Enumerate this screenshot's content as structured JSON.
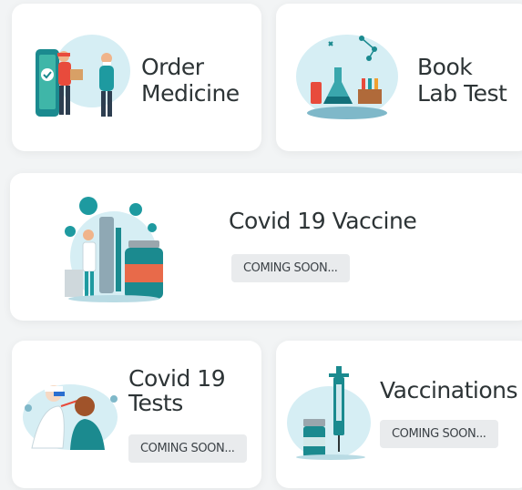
{
  "cards": {
    "order_medicine": {
      "title_line1": "Order",
      "title_line2": "Medicine",
      "icon": "medicine-delivery-icon"
    },
    "book_lab_test": {
      "title_line1": "Book",
      "title_line2": "Lab Test",
      "icon": "lab-flask-icon"
    },
    "covid_vaccine": {
      "title": "Covid 19 Vaccine",
      "badge": "COMING SOON...",
      "icon": "vaccine-vial-icon"
    },
    "covid_tests": {
      "title_line1": "Covid 19",
      "title_line2": "Tests",
      "badge": "COMING SOON...",
      "icon": "swab-test-icon"
    },
    "vaccinations": {
      "title": "Vaccinations",
      "badge": "COMING SOON...",
      "icon": "syringe-icon"
    }
  },
  "colors": {
    "accent_teal": "#1b8a8f",
    "light_blue": "#d6eef4",
    "badge_bg": "#e9ebed"
  }
}
